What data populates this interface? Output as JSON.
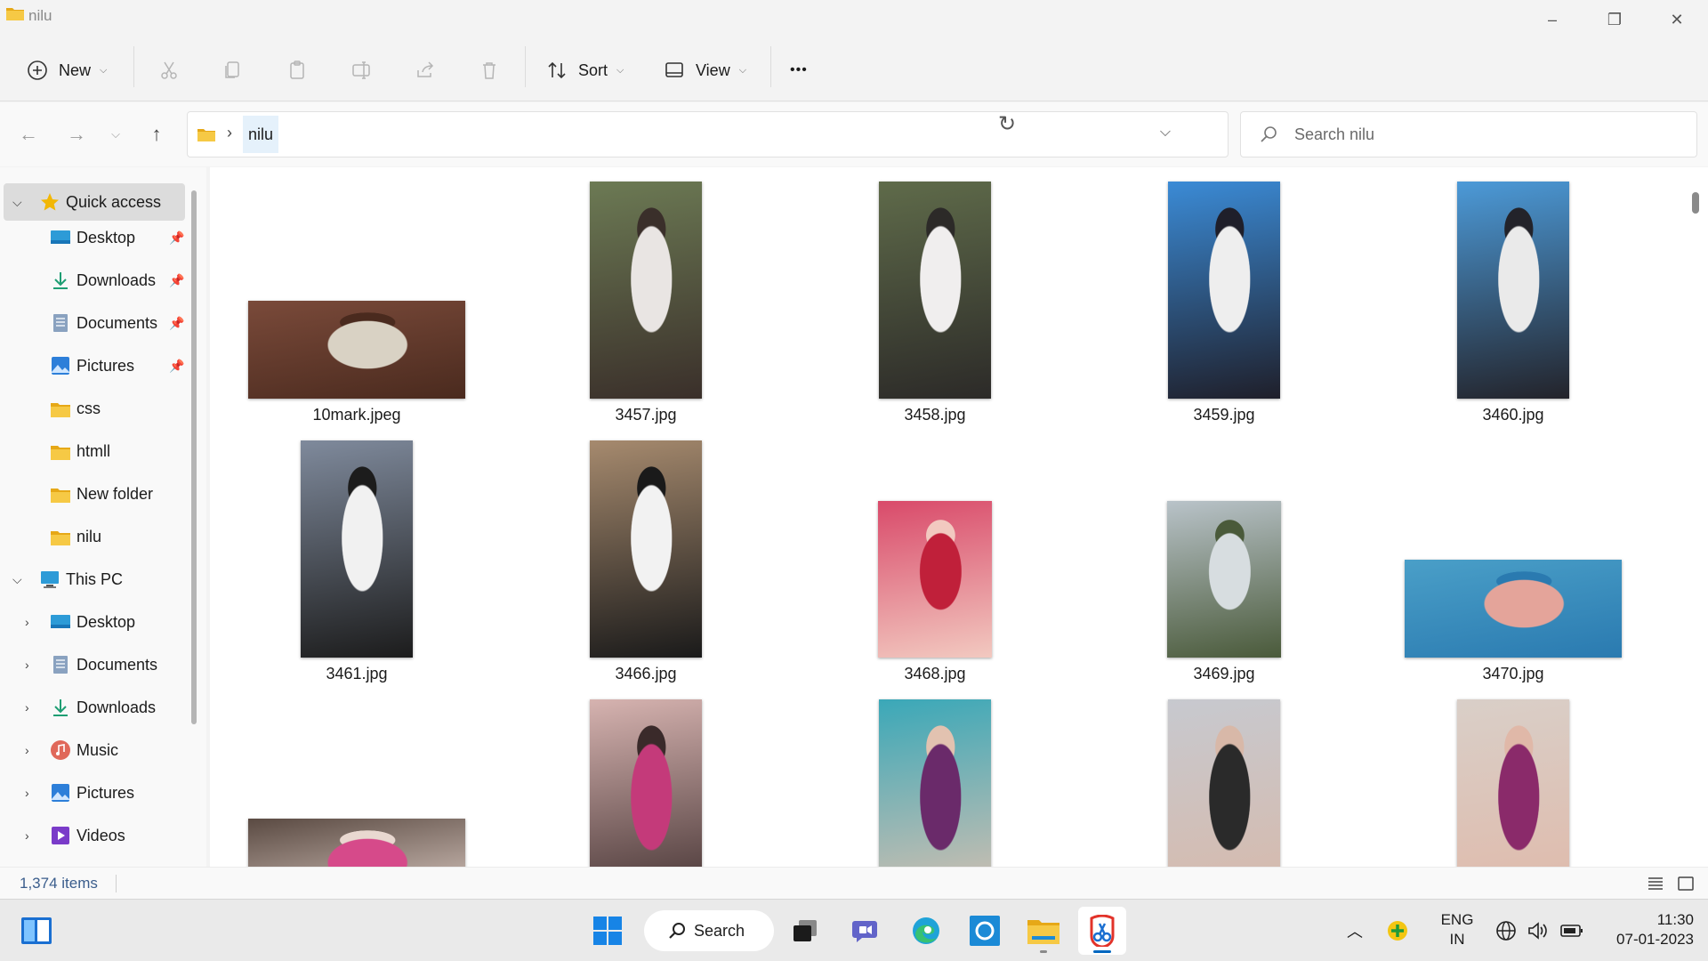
{
  "window": {
    "title": "nilu",
    "controls": {
      "minimize": "–",
      "maximize": "❐",
      "close": "✕"
    }
  },
  "toolbar": {
    "new_label": "New",
    "sort_label": "Sort",
    "view_label": "View",
    "more_label": "•••"
  },
  "address": {
    "crumb": "nilu",
    "search_placeholder": "Search nilu"
  },
  "sidebar": {
    "quick_access": "Quick access",
    "pinned": [
      {
        "label": "Desktop",
        "icon": "desktop-icon"
      },
      {
        "label": "Downloads",
        "icon": "download-icon"
      },
      {
        "label": "Documents",
        "icon": "documents-icon"
      },
      {
        "label": "Pictures",
        "icon": "pictures-icon"
      }
    ],
    "folders": [
      {
        "label": "css"
      },
      {
        "label": "htmll"
      },
      {
        "label": "New folder"
      },
      {
        "label": "nilu"
      }
    ],
    "this_pc": "This PC",
    "pc_items": [
      {
        "label": "Desktop"
      },
      {
        "label": "Documents"
      },
      {
        "label": "Downloads"
      },
      {
        "label": "Music"
      },
      {
        "label": "Pictures"
      },
      {
        "label": "Videos"
      }
    ]
  },
  "files": [
    {
      "name": "10mark.jpeg",
      "orientation": "landscape",
      "palette": [
        "#7a4a3a",
        "#d9d2c4",
        "#4a2a1e"
      ]
    },
    {
      "name": "3457.jpg",
      "orientation": "portrait",
      "palette": [
        "#6c7a54",
        "#e9e5e3",
        "#3a2f2a"
      ]
    },
    {
      "name": "3458.jpg",
      "orientation": "portrait",
      "palette": [
        "#5f6b4a",
        "#f0eeee",
        "#2c2a28"
      ]
    },
    {
      "name": "3459.jpg",
      "orientation": "portrait",
      "palette": [
        "#3b8bd6",
        "#eeeeee",
        "#1f1f2a"
      ]
    },
    {
      "name": "3460.jpg",
      "orientation": "portrait",
      "palette": [
        "#4c9ad8",
        "#eaeaea",
        "#23232a"
      ]
    },
    {
      "name": "3461.jpg",
      "orientation": "portrait",
      "palette": [
        "#7f8a9c",
        "#f1f1f1",
        "#1c1c1c"
      ]
    },
    {
      "name": "3466.jpg",
      "orientation": "portrait",
      "palette": [
        "#a68a6e",
        "#f2f2f2",
        "#1a1a1a"
      ]
    },
    {
      "name": "3468.jpg",
      "orientation": "landscape-tall",
      "palette": [
        "#d94a6a",
        "#c0203a",
        "#f2c9c0"
      ]
    },
    {
      "name": "3469.jpg",
      "orientation": "landscape-tall",
      "palette": [
        "#b9c3c9",
        "#d7dde0",
        "#4a5a3a"
      ]
    },
    {
      "name": "3470.jpg",
      "orientation": "landscape",
      "palette": [
        "#4a9fc8",
        "#e4a49a",
        "#2a7ab0"
      ]
    },
    {
      "name": "",
      "orientation": "landscape",
      "palette": [
        "#5a4a42",
        "#d64a8a",
        "#e9d8d0"
      ]
    },
    {
      "name": "",
      "orientation": "portrait",
      "palette": [
        "#d6b3b0",
        "#c43a7a",
        "#3a2a2a"
      ]
    },
    {
      "name": "",
      "orientation": "portrait",
      "palette": [
        "#3aa8b8",
        "#6a2a6a",
        "#e2c2b0"
      ]
    },
    {
      "name": "",
      "orientation": "portrait",
      "palette": [
        "#c7c9cf",
        "#2a2a2a",
        "#d8b8a8"
      ]
    },
    {
      "name": "",
      "orientation": "portrait",
      "palette": [
        "#d9cfc8",
        "#8a2a6a",
        "#e0b8a8"
      ]
    }
  ],
  "status": {
    "item_count": "1,374 items"
  },
  "taskbar": {
    "search_label": "Search",
    "tray": {
      "lang_top": "ENG",
      "lang_bottom": "IN",
      "time": "11:30",
      "date": "07-01-2023"
    }
  },
  "colors": {
    "accent": "#0067c0",
    "folder": "#f4c542",
    "folder_dark": "#e6a817",
    "selection": "#e5f1fb"
  }
}
